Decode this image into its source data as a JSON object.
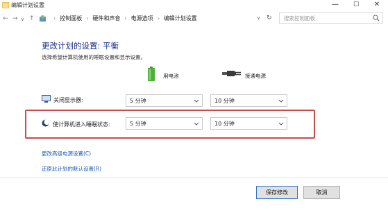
{
  "window": {
    "title": "编辑计划设置",
    "controls": [
      "—",
      "☐",
      "✕"
    ]
  },
  "addressbar": {
    "crumbs": [
      "控制面板",
      "硬件和声音",
      "电源选项",
      "编辑计划设置"
    ],
    "search_placeholder": "搜索控制面板"
  },
  "main": {
    "title": "更改计划的设置: 平衡",
    "subtitle": "选择希望计算机使用的睡眠设置和显示设置。",
    "columns": {
      "battery": "用电池",
      "plugged": "接通电源"
    },
    "rows": [
      {
        "label": "关闭显示器:",
        "battery_value": "5 分钟",
        "plugged_value": "10 分钟"
      },
      {
        "label": "使计算机进入睡眠状态:",
        "battery_value": "5 分钟",
        "plugged_value": "10 分钟"
      }
    ],
    "links": {
      "advanced": "更改高级电源设置(C)",
      "restore": "还原此计划的默认设置(R)"
    }
  },
  "footer": {
    "save": "保存修改",
    "cancel": "取消"
  },
  "colors": {
    "title_blue": "#1e3287",
    "link_blue": "#1a5ab4",
    "highlight_red": "#c84b4b",
    "battery_green": "#4caf3a"
  }
}
